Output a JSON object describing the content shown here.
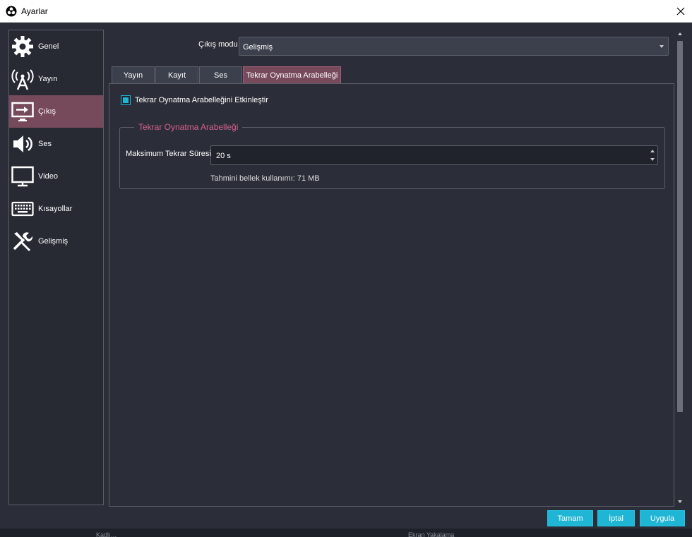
{
  "window": {
    "title": "Ayarlar",
    "app_icon": "obs-icon",
    "close_icon": "close-icon"
  },
  "sidebar": {
    "items": [
      {
        "label": "Genel",
        "icon": "gear-icon",
        "active": false
      },
      {
        "label": "Yayın",
        "icon": "broadcast-antenna-icon",
        "active": false
      },
      {
        "label": "Çıkış",
        "icon": "output-monitor-icon",
        "active": true
      },
      {
        "label": "Ses",
        "icon": "speaker-icon",
        "active": false
      },
      {
        "label": "Video",
        "icon": "monitor-icon",
        "active": false
      },
      {
        "label": "Kısayollar",
        "icon": "keyboard-icon",
        "active": false
      },
      {
        "label": "Gelişmiş",
        "icon": "tools-icon",
        "active": false
      }
    ]
  },
  "output_mode": {
    "label": "Çıkış modu",
    "value": "Gelişmiş"
  },
  "tabs": [
    {
      "label": "Yayın",
      "active": false
    },
    {
      "label": "Kayıt",
      "active": false
    },
    {
      "label": "Ses",
      "active": false
    },
    {
      "label": "Tekrar Oynatma Arabelleği",
      "active": true
    }
  ],
  "replay_buffer": {
    "enable_label": "Tekrar Oynatma Arabelleğini Etkinleştir",
    "enabled": true,
    "group_title": "Tekrar Oynatma Arabelleği",
    "max_time_label": "Maksimum Tekrar Süresi",
    "max_time_value": "20 s",
    "memory_usage": "Tahmini bellek kullanımı: 71 MB"
  },
  "buttons": {
    "ok": "Tamam",
    "cancel": "İptal",
    "apply": "Uygula"
  },
  "colors": {
    "accent": "#1fb5d4",
    "active_tab": "#76495b",
    "group_title": "#d65f8f",
    "background": "#2b2e38"
  },
  "background_strip": {
    "text_left": "Kadlı…",
    "text_right": "Ekran Yakalama"
  }
}
